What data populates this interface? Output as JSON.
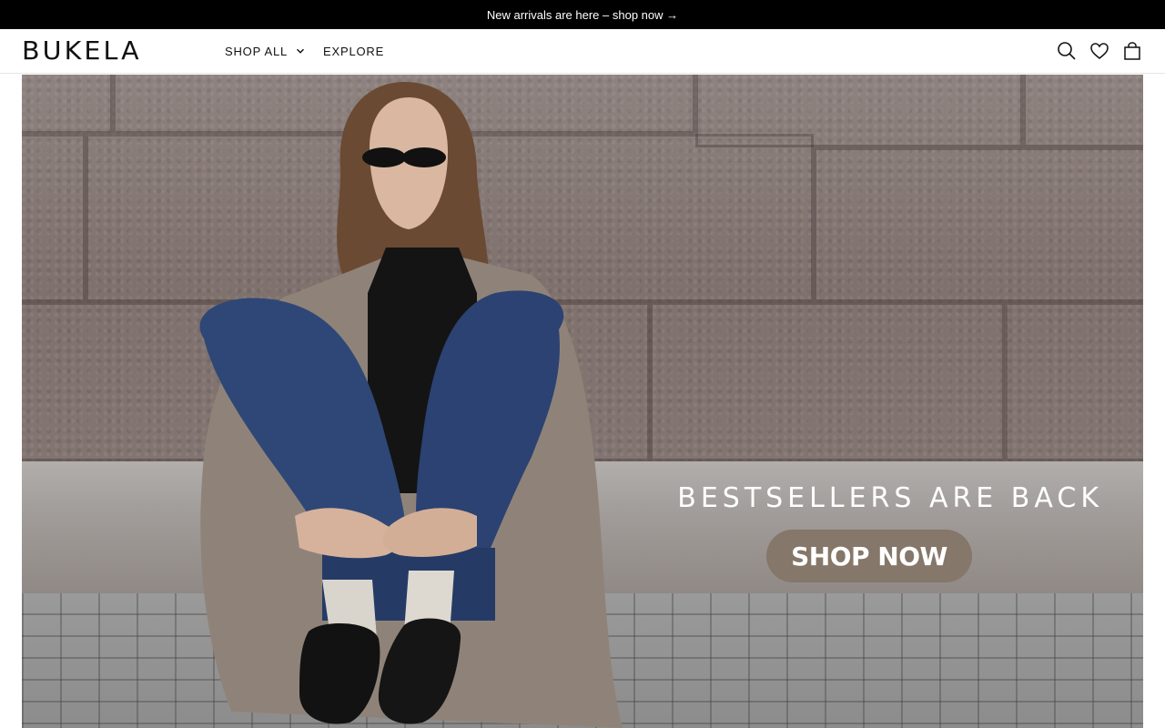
{
  "announcement": {
    "text": "New arrivals are here – shop now →"
  },
  "header": {
    "logo": "BUKELA",
    "nav": [
      {
        "label": "SHOP ALL",
        "has_dropdown": true,
        "icon": "chevron-down-icon"
      },
      {
        "label": "EXPLORE",
        "has_dropdown": false
      }
    ],
    "icons": [
      "search-icon",
      "heart-icon",
      "bag-icon"
    ]
  },
  "hero": {
    "headline": "BESTSELLERS ARE BACK",
    "cta_label": "SHOP NOW",
    "cta_color": "#857769"
  }
}
